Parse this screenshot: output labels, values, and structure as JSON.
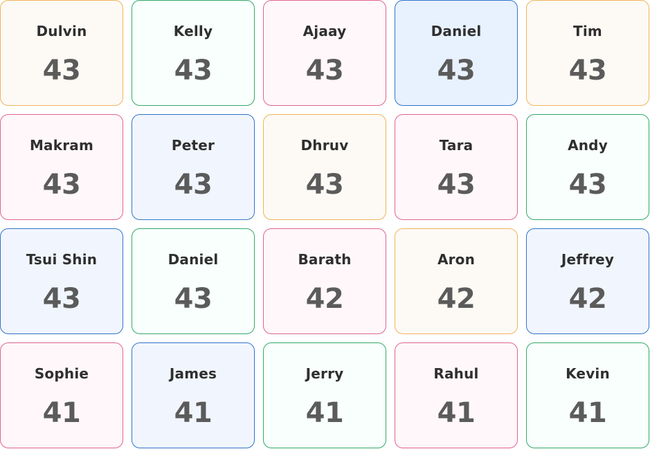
{
  "cards": [
    {
      "name": "Dulvin",
      "score": "43",
      "color": "#f0b35a"
    },
    {
      "name": "Kelly",
      "score": "43",
      "color": "#33a86a"
    },
    {
      "name": "Ajaay",
      "score": "43",
      "color": "#e0648f"
    },
    {
      "name": "Daniel",
      "score": "43",
      "color": "#2f74c8"
    },
    {
      "name": "Tim",
      "score": "43",
      "color": "#f0b35a"
    },
    {
      "name": "Makram",
      "score": "43",
      "color": "#e0648f"
    },
    {
      "name": "Peter",
      "score": "43",
      "color": "#2f74c8"
    },
    {
      "name": "Dhruv",
      "score": "43",
      "color": "#f0b35a"
    },
    {
      "name": "Tara",
      "score": "43",
      "color": "#e0648f"
    },
    {
      "name": "Andy",
      "score": "43",
      "color": "#33a86a"
    },
    {
      "name": "Tsui Shin",
      "score": "43",
      "color": "#2f74c8"
    },
    {
      "name": "Daniel",
      "score": "43",
      "color": "#33a86a"
    },
    {
      "name": "Barath",
      "score": "42",
      "color": "#e0648f"
    },
    {
      "name": "Aron",
      "score": "42",
      "color": "#f0b35a"
    },
    {
      "name": "Jeffrey",
      "score": "42",
      "color": "#2f74c8"
    },
    {
      "name": "Sophie",
      "score": "41",
      "color": "#e0648f"
    },
    {
      "name": "James",
      "score": "41",
      "color": "#2f74c8"
    },
    {
      "name": "Jerry",
      "score": "41",
      "color": "#33a86a"
    },
    {
      "name": "Rahul",
      "score": "41",
      "color": "#e0648f"
    },
    {
      "name": "Kevin",
      "score": "41",
      "color": "#33a86a"
    }
  ]
}
